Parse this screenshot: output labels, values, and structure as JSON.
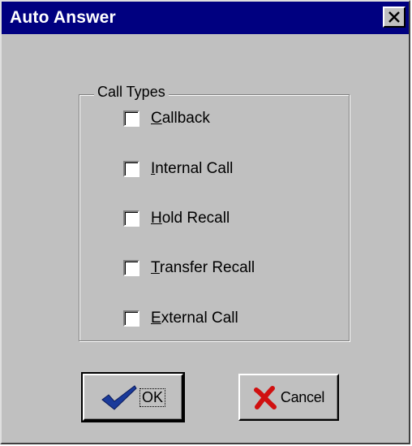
{
  "window": {
    "title": "Auto Answer"
  },
  "group": {
    "label": "Call Types",
    "items": [
      {
        "mnemonic": "C",
        "rest": "allback",
        "checked": false
      },
      {
        "mnemonic": "I",
        "rest": "nternal Call",
        "checked": false
      },
      {
        "mnemonic": "H",
        "rest": "old Recall",
        "checked": false
      },
      {
        "mnemonic": "T",
        "rest": "ransfer Recall",
        "checked": false
      },
      {
        "mnemonic": "E",
        "rest": "xternal Call",
        "checked": false
      }
    ]
  },
  "buttons": {
    "ok_label": "OK",
    "cancel_label": "Cancel"
  },
  "icons": {
    "close": "close-icon",
    "ok": "checkmark-icon",
    "cancel": "red-x-icon"
  },
  "colors": {
    "titlebar": "#000080",
    "face": "#c0c0c0",
    "checkmark": "#1a3a9a",
    "cancel_x": "#d01010"
  }
}
